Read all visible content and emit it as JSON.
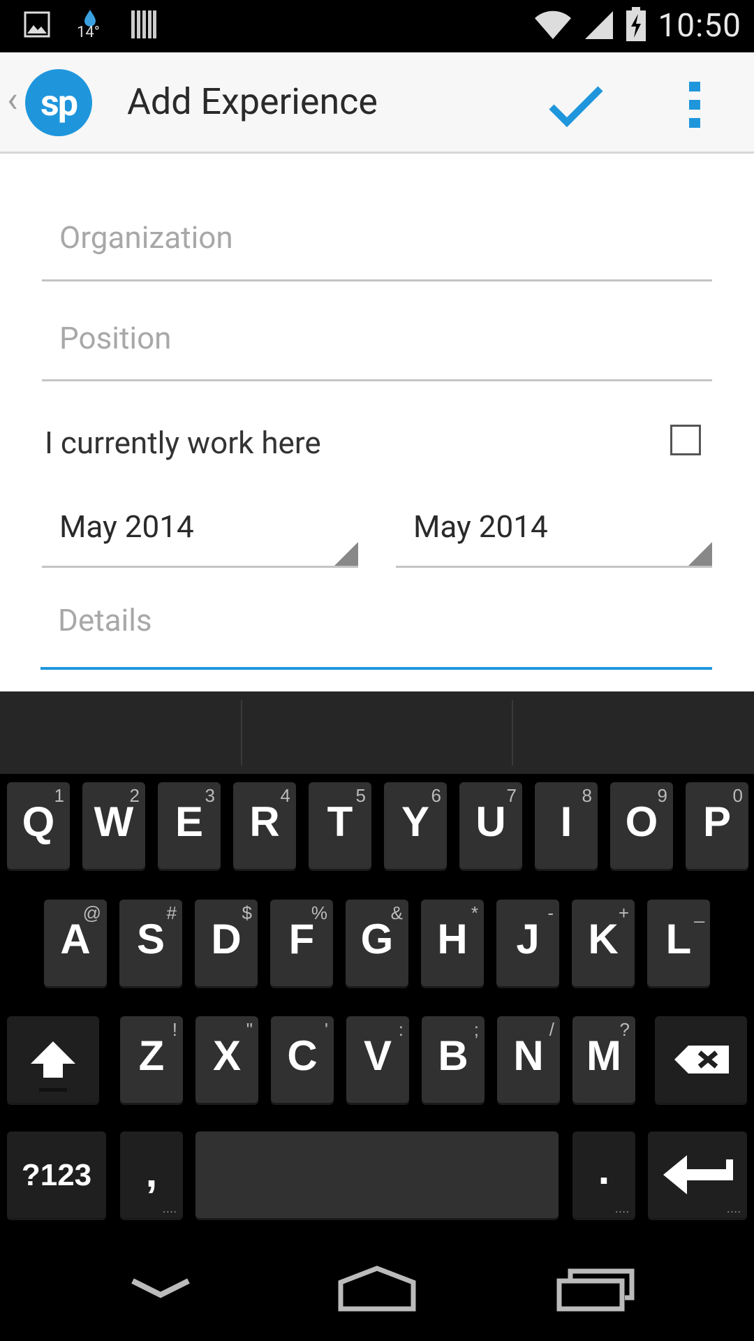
{
  "status_bar": {
    "temperature": "14°",
    "time": "10:50"
  },
  "action_bar": {
    "back": "‹",
    "logo_text": "sp",
    "title": "Add Experience",
    "accent_color": "#1f96dc"
  },
  "form": {
    "organization": {
      "value": "",
      "placeholder": "Organization"
    },
    "position": {
      "value": "",
      "placeholder": "Position"
    },
    "current_job_label": "I currently work here",
    "current_job_checked": false,
    "start_date": "May 2014",
    "end_date": "May 2014",
    "details": {
      "value": "",
      "placeholder": "Details"
    }
  },
  "keyboard": {
    "row1": [
      {
        "label": "Q",
        "hint": "1"
      },
      {
        "label": "W",
        "hint": "2"
      },
      {
        "label": "E",
        "hint": "3"
      },
      {
        "label": "R",
        "hint": "4"
      },
      {
        "label": "T",
        "hint": "5"
      },
      {
        "label": "Y",
        "hint": "6"
      },
      {
        "label": "U",
        "hint": "7"
      },
      {
        "label": "I",
        "hint": "8"
      },
      {
        "label": "O",
        "hint": "9"
      },
      {
        "label": "P",
        "hint": "0"
      }
    ],
    "row2": [
      {
        "label": "A",
        "hint": "@"
      },
      {
        "label": "S",
        "hint": "#"
      },
      {
        "label": "D",
        "hint": "$"
      },
      {
        "label": "F",
        "hint": "%"
      },
      {
        "label": "G",
        "hint": "&"
      },
      {
        "label": "H",
        "hint": "*"
      },
      {
        "label": "J",
        "hint": "-"
      },
      {
        "label": "K",
        "hint": "+"
      },
      {
        "label": "L",
        "hint": "_"
      }
    ],
    "row3": [
      {
        "label": "Z",
        "hint": "!"
      },
      {
        "label": "X",
        "hint": "\""
      },
      {
        "label": "C",
        "hint": "'"
      },
      {
        "label": "V",
        "hint": ":"
      },
      {
        "label": "B",
        "hint": ";"
      },
      {
        "label": "N",
        "hint": "/"
      },
      {
        "label": "M",
        "hint": "?"
      }
    ],
    "symbols_label": "?123",
    "comma_label": ",",
    "period_label": ".",
    "more_dots": "...."
  },
  "icons": {
    "status_left": [
      "image-icon",
      "water-drop-icon",
      "barcode-icon"
    ],
    "status_right": [
      "wifi-icon",
      "signal-icon",
      "battery-charging-icon"
    ],
    "action": [
      "check-icon",
      "overflow-menu-icon"
    ],
    "keyboard": [
      "shift-icon",
      "backspace-icon",
      "enter-icon"
    ],
    "nav": [
      "back-down-icon",
      "home-icon",
      "recents-icon"
    ]
  }
}
